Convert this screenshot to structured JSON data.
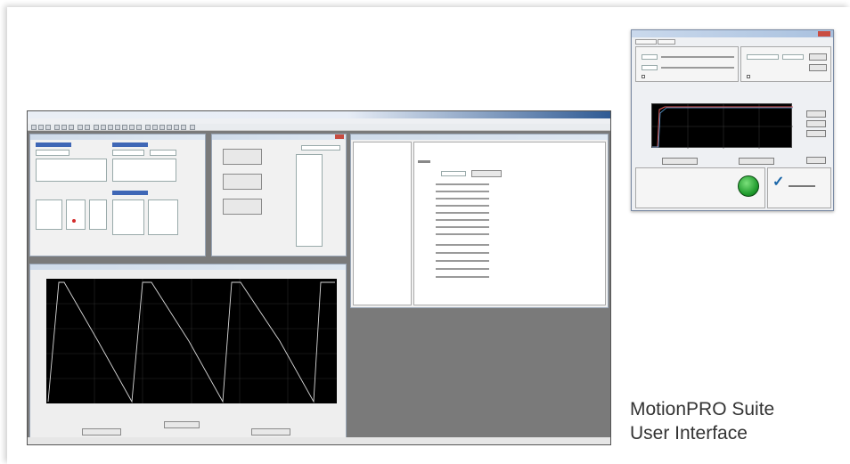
{
  "caption": {
    "line1": "MotionPRO Suite",
    "line2": "User Interface"
  },
  "icons": {
    "go": "green-go-button-icon",
    "check": "checkmark-icon"
  },
  "colors": {
    "caption_text": "#333333",
    "workspace": "#7a7a7a",
    "plot_background": "#000000",
    "header_blue": "#3f67b6",
    "go_button": "#1e9a2c",
    "check_mark": "#1a66a8"
  },
  "check_glyph": "✓"
}
